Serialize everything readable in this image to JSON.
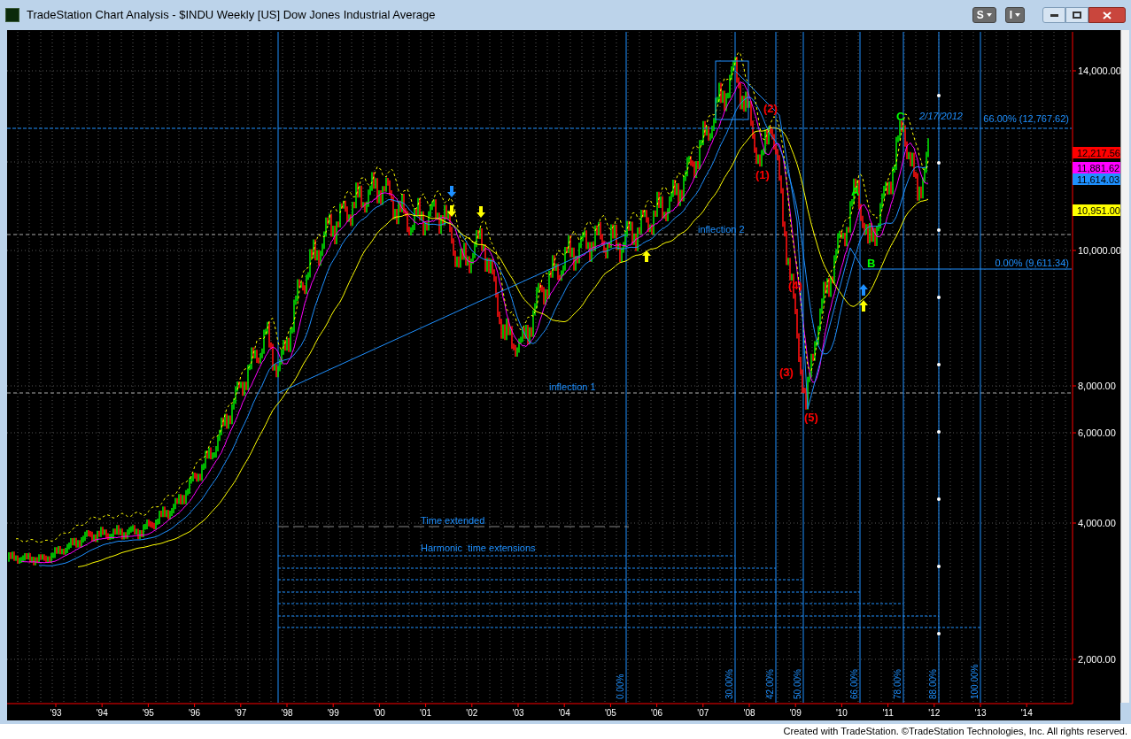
{
  "window": {
    "title": "TradeStation Chart Analysis - $INDU Weekly [US] Dow Jones Industrial Average"
  },
  "toolbar_buttons": [
    "S",
    "I"
  ],
  "price_axis": {
    "ticks": [
      "14,000.00",
      "10,000.00",
      "8,000.00",
      "6,000.00",
      "4,000.00",
      "2,000.00"
    ],
    "last_values": [
      {
        "value": "12,217.56",
        "color": "#ff0000"
      },
      {
        "value": "11,881.62",
        "color": "#ff00ff"
      },
      {
        "value": "11,614.03",
        "color": "#1e90ff"
      },
      {
        "value": "10,951.00",
        "color": "#ffff00"
      }
    ]
  },
  "time_axis": {
    "ticks": [
      "'93",
      "'94",
      "'95",
      "'96",
      "'97",
      "'98",
      "'99",
      "'00",
      "'01",
      "'02",
      "'03",
      "'04",
      "'05",
      "'06",
      "'07",
      "'08",
      "'09",
      "'10",
      "'11",
      "'12",
      "'13",
      "'14"
    ]
  },
  "fib_time_labels": [
    "0.00%",
    "30.00%",
    "42.00%",
    "50.00%",
    "66.00%",
    "78.00%",
    "88.00%",
    "100.00%"
  ],
  "price_levels": [
    {
      "label": "66.00% (12,767.62)"
    },
    {
      "label": "0.00% (9,611.34)"
    }
  ],
  "date_label": "2/17/2012",
  "wave_labels": [
    {
      "text": "(1)",
      "color": "#ff0000"
    },
    {
      "text": "(2)",
      "color": "#ff0000"
    },
    {
      "text": "(3)",
      "color": "#ff0000"
    },
    {
      "text": "(4)",
      "color": "#ff0000"
    },
    {
      "text": "(5)",
      "color": "#ff0000"
    },
    {
      "text": "A",
      "color": "#00ff00"
    },
    {
      "text": "B",
      "color": "#00ff00"
    },
    {
      "text": "C",
      "color": "#00ff00"
    }
  ],
  "notes": [
    "inflection 1",
    "inflection 2",
    "Time extended",
    "Harmonic  time extensions"
  ],
  "footer": "Created with TradeStation. ©TradeStation Technologies, Inc. All rights reserved."
}
